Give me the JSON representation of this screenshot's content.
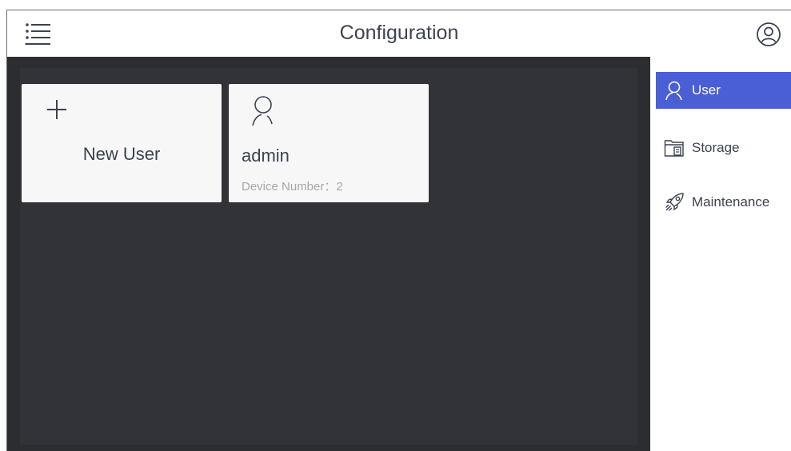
{
  "header": {
    "title": "Configuration",
    "menu_icon": "list-menu-icon",
    "account_icon": "user-circle-icon"
  },
  "cards": {
    "new_user": {
      "label": "New User",
      "icon": "plus-icon"
    },
    "users": [
      {
        "name": "admin",
        "device_number": "Device Number：2",
        "icon": "user-outline-icon"
      }
    ]
  },
  "sidebar": {
    "items": [
      {
        "label": "User",
        "icon": "user-outline-icon",
        "active": true
      },
      {
        "label": "Storage",
        "icon": "storage-icon",
        "active": false
      },
      {
        "label": "Maintenance",
        "icon": "rocket-icon",
        "active": false
      }
    ]
  },
  "colors": {
    "accent": "#4a5ed6",
    "content_bg": "#2b2d31",
    "card_bg": "#f7f7f7",
    "text": "#3b4250",
    "muted_text": "#a7a7a7"
  }
}
